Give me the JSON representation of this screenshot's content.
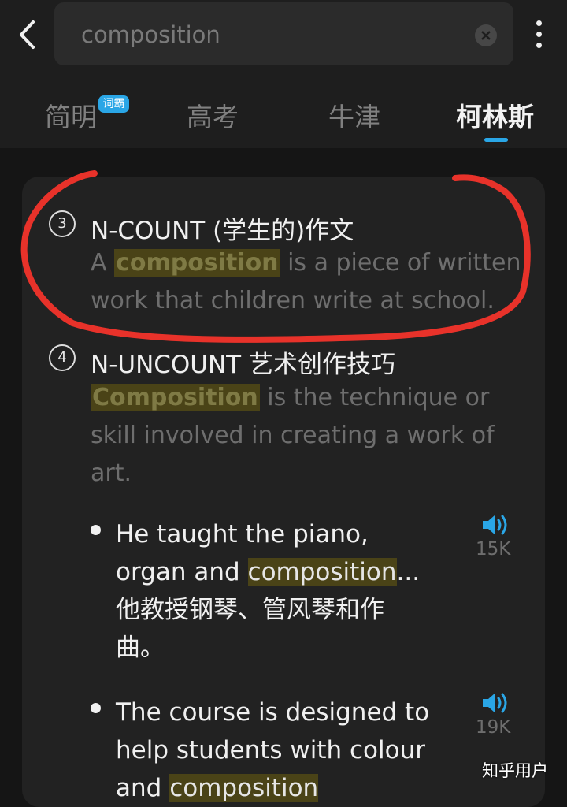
{
  "search": {
    "value": "composition"
  },
  "tabs": [
    {
      "label": "简明",
      "badge": "词霸"
    },
    {
      "label": "高考"
    },
    {
      "label": "牛津"
    },
    {
      "label": "柯林斯",
      "active": true
    }
  ],
  "senses": [
    {
      "number": "3",
      "heading": "N-COUNT (学生的)作文",
      "def_before": "A ",
      "def_highlight": "composition",
      "def_after": " is a piece of written work that children write at school."
    },
    {
      "number": "4",
      "heading": "N-UNCOUNT 艺术创作技巧",
      "def_highlight": "Composition",
      "def_after": " is the technique or skill involved in creating a work of art."
    }
  ],
  "examples": [
    {
      "en_before": "He taught the piano, organ and ",
      "en_highlight": "composition",
      "en_after": "...",
      "zh": "他教授钢琴、管风琴和作曲。",
      "count": "15K"
    },
    {
      "en_before": "The course is designed to help students with colour and ",
      "en_highlight": "composition",
      "en_after": "",
      "count": "19K"
    }
  ],
  "watermark": "知乎用户",
  "colors": {
    "accent": "#2aa6e6",
    "highlight_bg": "#4a4317",
    "annotation": "#e8322a"
  },
  "icons": [
    "back-arrow-icon",
    "clear-icon",
    "more-vertical-icon",
    "speaker-icon"
  ]
}
